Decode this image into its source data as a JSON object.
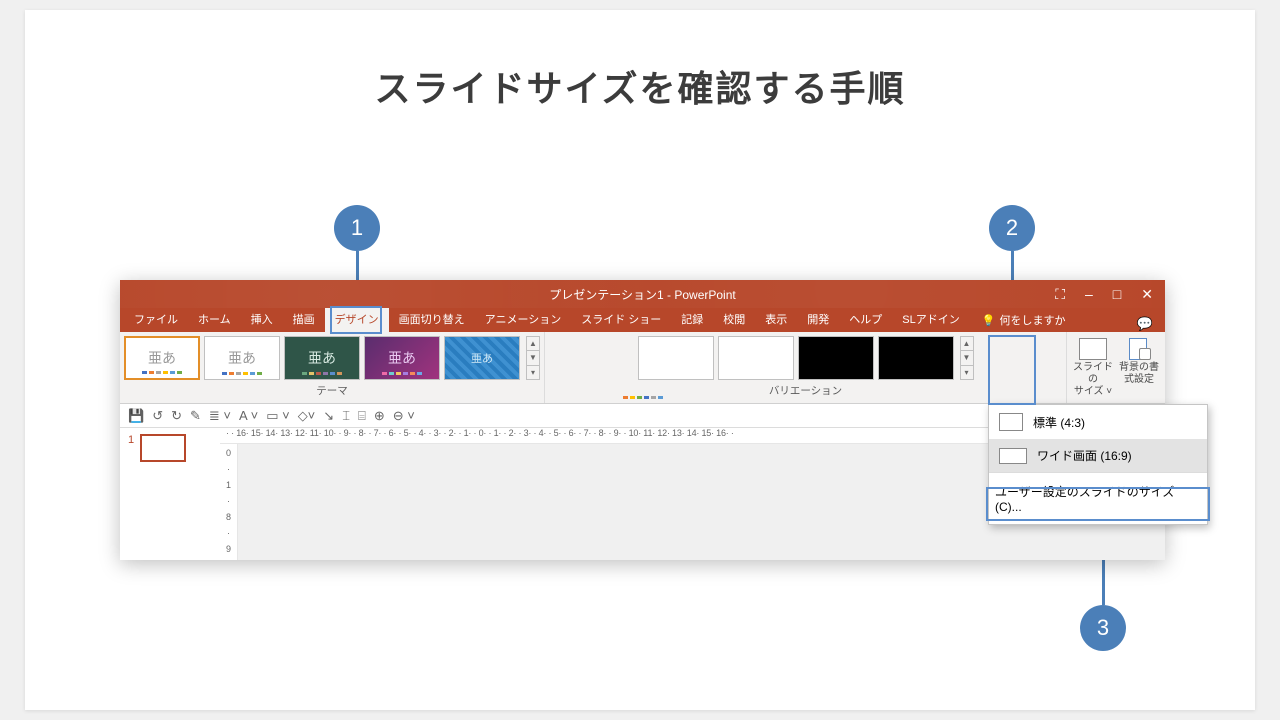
{
  "title": "スライドサイズを確認する手順",
  "badges": {
    "one": "1",
    "two": "2",
    "three": "3"
  },
  "window": {
    "title": "プレゼンテーション1  -  PowerPoint",
    "minimize": "–",
    "maximize": "□",
    "close": "✕",
    "displaySettings": "⛶"
  },
  "tabs": {
    "file": "ファイル",
    "home": "ホーム",
    "insert": "挿入",
    "draw": "描画",
    "design": "デザイン",
    "transitions": "画面切り替え",
    "animations": "アニメーション",
    "slideshow": "スライド ショー",
    "record": "記録",
    "review": "校閲",
    "view": "表示",
    "developer": "開発",
    "help": "ヘルプ",
    "addin": "SLアドイン",
    "tellme": "何をしますか"
  },
  "groups": {
    "themes": "テーマ",
    "variations": "バリエーション",
    "themeSample": "亜あ"
  },
  "customize": {
    "slideSize": "スライドの\nサイズ ˅",
    "formatBg": "背景の書\n式設定"
  },
  "dropdown": {
    "standard": "標準 (4:3)",
    "wide": "ワイド画面 (16:9)",
    "custom": "ユーザー設定のスライドのサイズ(C)..."
  },
  "ruler": "· · 16· 15· 14· 13· 12· 11· 10· · 9· · 8· · 7· · 6· · 5· · 4· · 3· · 2· · 1· · 0· · 1· · 2· · 3· · 4· · 5· · 6· · 7· · 8· · 9· · 10· 11· 12· 13· 14· 15· 16· ·",
  "vruler": [
    "0",
    "·",
    "1",
    "·",
    "8",
    "·",
    "9"
  ],
  "thumb": {
    "num": "1"
  },
  "qatGlyphs": {
    "save": "💾",
    "undo": "↺",
    "redo": "↻",
    "paint": "✎",
    "bullets": "≣ ˅",
    "font": "A ˅",
    "color": "▭ ˅",
    "shape": "◇˅",
    "arrow": "↘",
    "text": "⌶",
    "group": "⌸",
    "zoomIn": "⊕",
    "zoomOut": "⊖ ˅"
  }
}
